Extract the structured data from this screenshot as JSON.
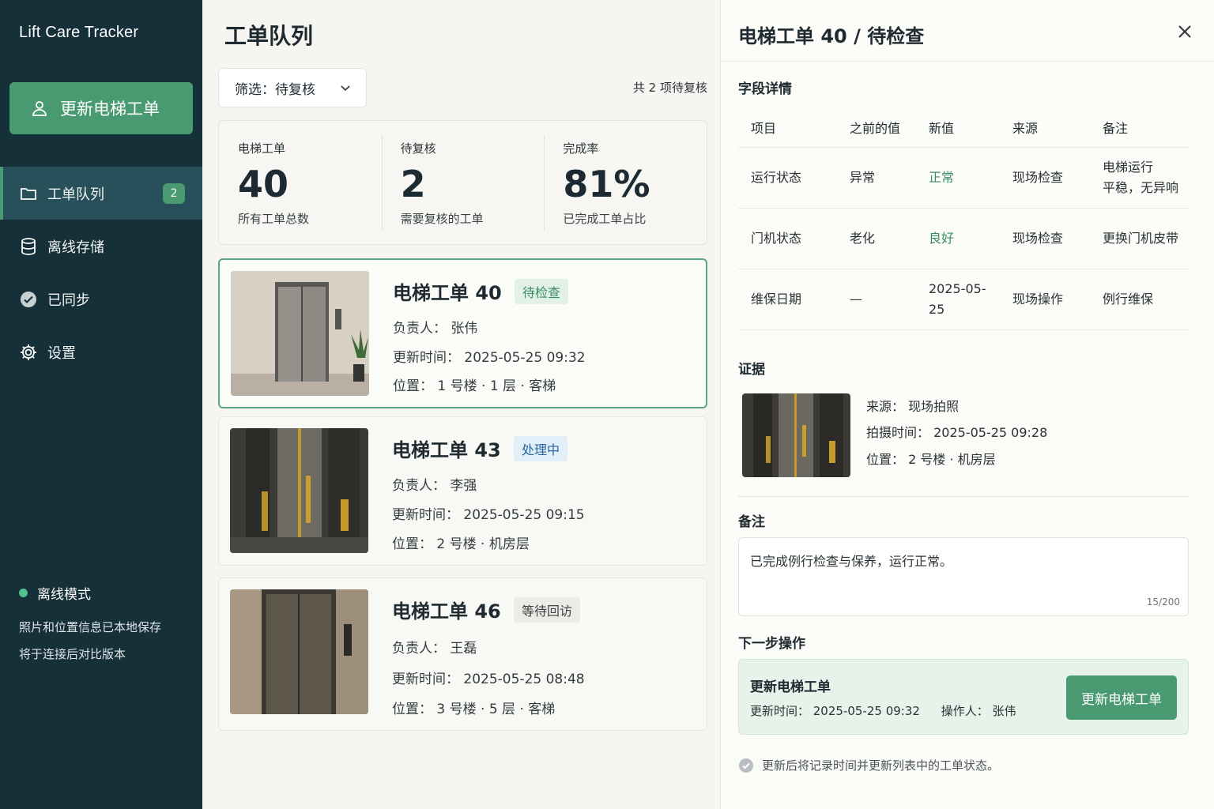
{
  "app": {
    "brand": "Lift Care Tracker"
  },
  "sidebar": {
    "primary_button": "更新电梯工单",
    "items": [
      {
        "label": "工单队列",
        "icon": "folder-icon",
        "badge": "2",
        "active": true
      },
      {
        "label": "离线存储",
        "icon": "database-icon"
      },
      {
        "label": "已同步",
        "icon": "check-circle-icon"
      },
      {
        "label": "设置",
        "icon": "gear-icon"
      }
    ],
    "offline": {
      "title": "离线模式",
      "lines": [
        "照片和位置信息已本地保存",
        "将于连接后对比版本"
      ]
    }
  },
  "main": {
    "title": "工单队列",
    "filter": {
      "label": "筛选：待复核"
    },
    "count_text": "共 2 项待复核",
    "stats": [
      {
        "label": "电梯工单",
        "value": "40",
        "sub": "所有工单总数"
      },
      {
        "label": "待复核",
        "value": "2",
        "sub": "需要复核的工单"
      },
      {
        "label": "完成率",
        "value": "81%",
        "sub": "已完成工单占比"
      }
    ],
    "cards": [
      {
        "title": "电梯工单 40",
        "tag": "待检查",
        "owner": "负责人：  张伟",
        "updated": "更新时间：  2025-05-25  09:32",
        "location": "位置：  1 号楼 · 1 层 · 客梯"
      },
      {
        "title": "电梯工单 43",
        "tag": "处理中",
        "owner": "负责人：  李强",
        "updated": "更新时间：  2025-05-25  09:15",
        "location": "位置：  2 号楼 · 机房层"
      },
      {
        "title": "电梯工单 46",
        "tag": "等待回访",
        "owner": "负责人：  王磊",
        "updated": "更新时间：  2025-05-25  08:48",
        "location": "位置：  3 号楼 · 5 层 · 客梯"
      }
    ]
  },
  "panel": {
    "title": "电梯工单 40 / 待检查",
    "fields_title": "字段详情",
    "columns": [
      "项目",
      "之前的值",
      "新值",
      "来源",
      "备注"
    ],
    "rows": [
      {
        "item": "运行状态",
        "before": "异常",
        "after": "正常",
        "source": "现场检查",
        "note": "电梯运行\n平稳，无异响"
      },
      {
        "item": "门机状态",
        "before": "老化",
        "after": "良好",
        "source": "现场检查",
        "note": "更换门机皮带"
      },
      {
        "item": "维保日期",
        "before": "—",
        "after": "2025-05-25",
        "source": "现场操作",
        "note": "例行维保"
      }
    ],
    "evidence_title": "证据",
    "evidence": {
      "source": "来源：  现场拍照",
      "time": "拍摄时间：  2025-05-25  09:28",
      "location": "位置：  2 号楼 · 机房层"
    },
    "notes_title": "备注",
    "note_text": "已完成例行检查与保养，运行正常。",
    "note_count": "15/200",
    "next_title": "下一步操作",
    "next": {
      "title": "更新电梯工单",
      "time": "更新时间：  2025-05-25  09:32",
      "operator": "操作人：  张伟",
      "button": "更新电梯工单"
    },
    "footnote": "更新后将记录时间并更新列表中的工单状态。"
  },
  "colors": {
    "sidebar": "#16303a",
    "accent": "#4a9a71",
    "active_nav": "#27505a",
    "new_value": "#3c8d62"
  }
}
